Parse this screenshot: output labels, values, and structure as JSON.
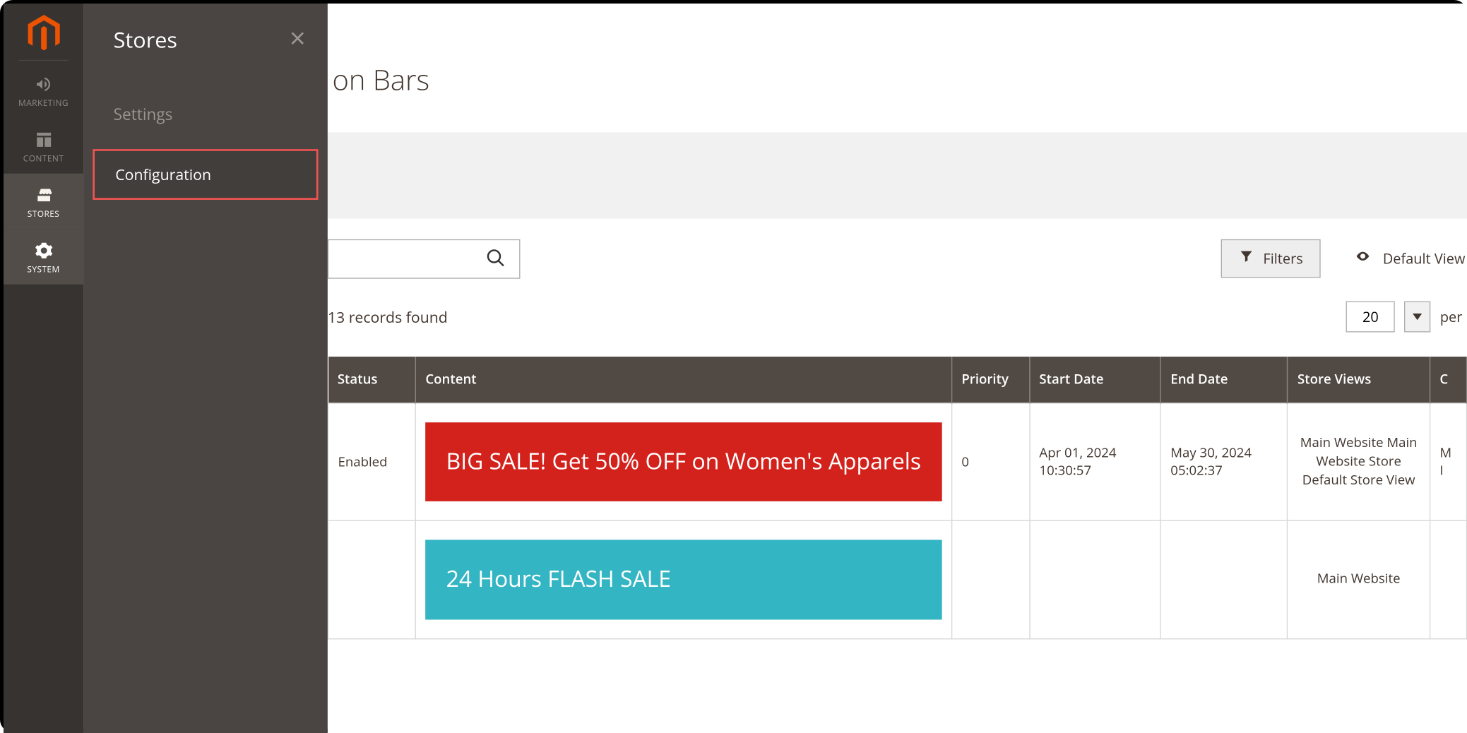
{
  "sidebar": {
    "items": [
      {
        "label": "MARKETING"
      },
      {
        "label": "CONTENT"
      },
      {
        "label": "STORES"
      },
      {
        "label": "SYSTEM"
      }
    ]
  },
  "flyout": {
    "title": "Stores",
    "section": "Settings",
    "item": "Configuration"
  },
  "page": {
    "title_visible": "on Bars"
  },
  "toolbar": {
    "filters": "Filters",
    "default_view": "Default View",
    "records_found": "13 records found",
    "page_size": "20",
    "per_prefix": "per p"
  },
  "table": {
    "headers": {
      "status": "Status",
      "content": "Content",
      "priority": "Priority",
      "start": "Start Date",
      "end": "End Date",
      "store": "Store Views",
      "last": "C"
    },
    "rows": [
      {
        "status": "Enabled",
        "banner": "BIG SALE! Get 50% OFF on Women's Apparels",
        "banner_style": "banner-red",
        "priority": "0",
        "start": "Apr 01, 2024 10:30:57",
        "end": "May 30, 2024 05:02:37",
        "store": "Main Website\n    Main Website Store\n        Default Store View",
        "last": "M\nI"
      },
      {
        "status": "",
        "banner": "24 Hours FLASH SALE",
        "banner_style": "banner-teal",
        "priority": "",
        "start": "",
        "end": "",
        "store": "Main Website",
        "last": ""
      }
    ]
  }
}
